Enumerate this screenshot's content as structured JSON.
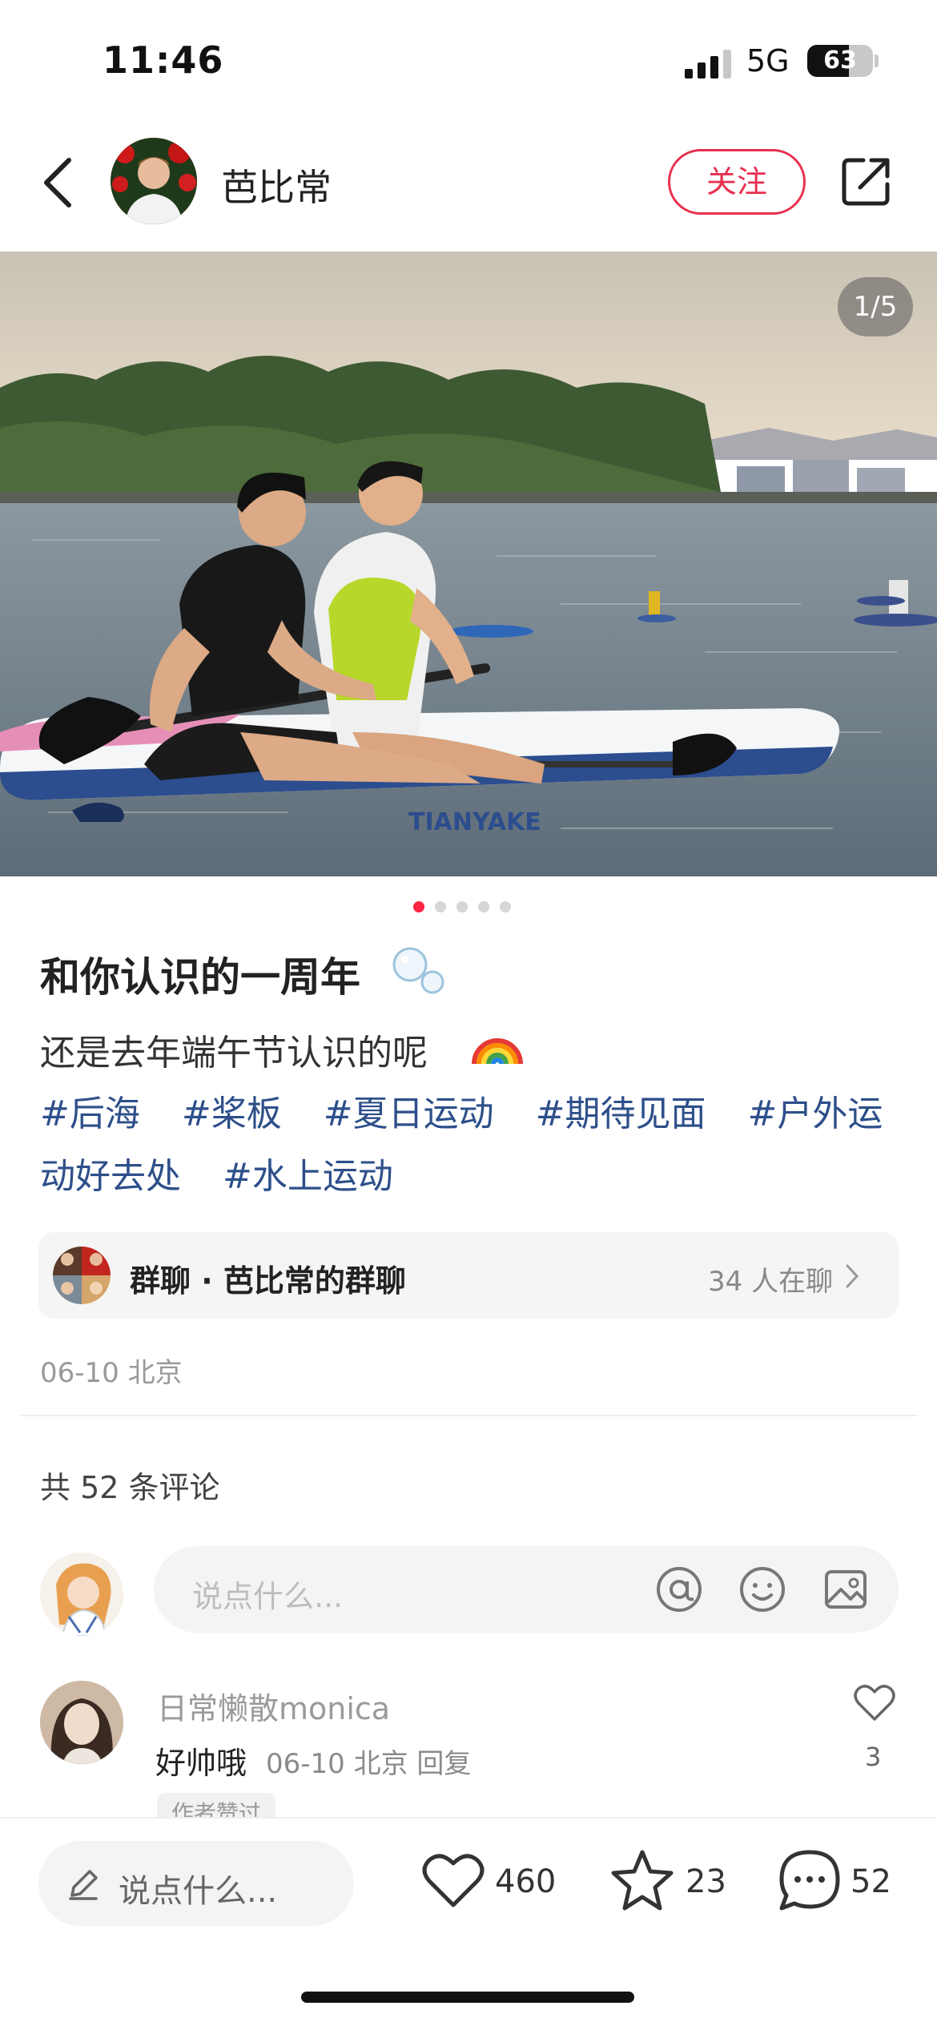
{
  "status_bar": {
    "time": "11:46",
    "network": "5G",
    "battery": "63",
    "battery_level_percent": 63
  },
  "header": {
    "author_name": "芭比常",
    "follow_label": "关注"
  },
  "photo": {
    "counter": "1/5",
    "board_text": "TIANYAKE"
  },
  "carousel": {
    "total": 5,
    "active_index": 0
  },
  "post": {
    "title": "和你认识的一周年",
    "description": "还是去年端午节认识的呢",
    "tags": [
      "#后海",
      "#桨板",
      "#夏日运动",
      "#期待见面",
      "#户外运动好去处",
      "#水上运动"
    ],
    "date_location": "06-10 北京"
  },
  "group_chat": {
    "label": "群聊 · 芭比常的群聊",
    "count_text": "34 人在聊"
  },
  "comments": {
    "count_text": "共 52 条评论",
    "input_placeholder": "说点什么...",
    "items": [
      {
        "user": "日常懒散monica",
        "text": "好帅哦",
        "meta": "06-10 北京 回复",
        "likes": "3",
        "badge": "作者赞过"
      }
    ]
  },
  "bottom_bar": {
    "input_placeholder": "说点什么...",
    "likes": "460",
    "favorites": "23",
    "comments": "52"
  },
  "colors": {
    "accent": "#ff2442",
    "follow": "#e8304f",
    "tag": "#2d4f8a"
  }
}
